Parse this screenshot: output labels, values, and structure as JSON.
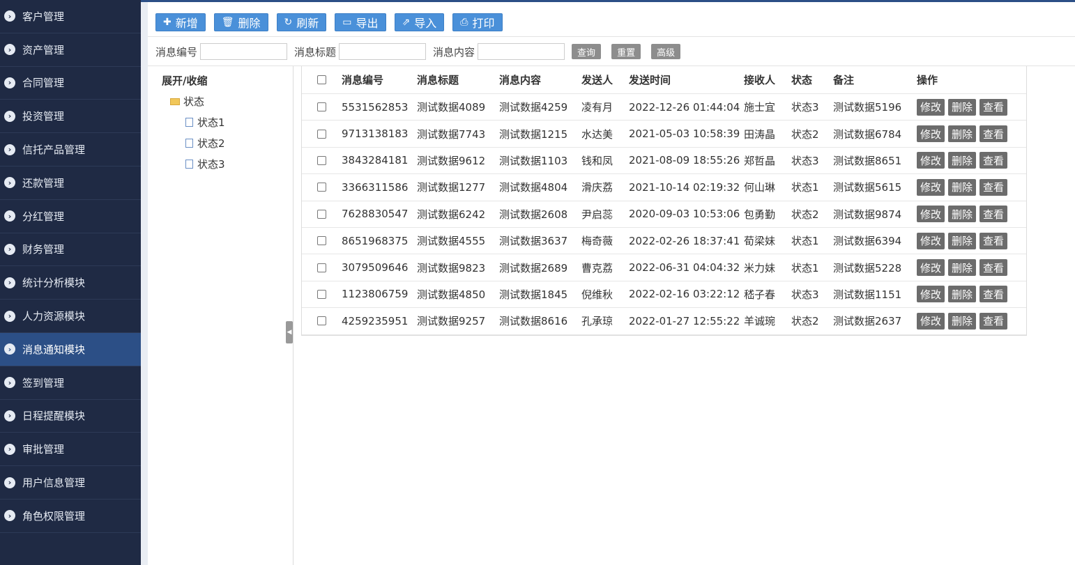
{
  "sidebar": {
    "items": [
      {
        "label": "客户管理",
        "icon": "chevron-right-circle-icon",
        "active": false
      },
      {
        "label": "资产管理",
        "icon": "chevron-right-circle-icon",
        "active": false
      },
      {
        "label": "合同管理",
        "icon": "chevron-right-circle-icon",
        "active": false
      },
      {
        "label": "投资管理",
        "icon": "chevron-right-circle-icon",
        "active": false
      },
      {
        "label": "信托产品管理",
        "icon": "chevron-right-circle-icon",
        "active": false
      },
      {
        "label": "还款管理",
        "icon": "chevron-right-circle-icon",
        "active": false
      },
      {
        "label": "分红管理",
        "icon": "chevron-right-circle-icon",
        "active": false
      },
      {
        "label": "财务管理",
        "icon": "chevron-right-circle-icon",
        "active": false
      },
      {
        "label": "统计分析模块",
        "icon": "chevron-right-circle-icon",
        "active": false
      },
      {
        "label": "人力资源模块",
        "icon": "chevron-right-circle-icon",
        "active": false
      },
      {
        "label": "消息通知模块",
        "icon": "chevron-right-circle-icon",
        "active": true
      },
      {
        "label": "签到管理",
        "icon": "chevron-right-circle-icon",
        "active": false
      },
      {
        "label": "日程提醒模块",
        "icon": "chevron-right-circle-icon",
        "active": false
      },
      {
        "label": "审批管理",
        "icon": "chevron-right-circle-icon",
        "active": false
      },
      {
        "label": "用户信息管理",
        "icon": "chevron-right-circle-icon",
        "active": false
      },
      {
        "label": "角色权限管理",
        "icon": "chevron-right-circle-icon",
        "active": false
      }
    ]
  },
  "toolbar": {
    "add": {
      "label": "新增",
      "icon": "plus-icon"
    },
    "delete": {
      "label": "删除",
      "icon": "trash-icon"
    },
    "refresh": {
      "label": "刷新",
      "icon": "refresh-icon"
    },
    "export": {
      "label": "导出",
      "icon": "folder-open-icon"
    },
    "import": {
      "label": "导入",
      "icon": "external-link-icon"
    },
    "print": {
      "label": "打印",
      "icon": "print-icon"
    }
  },
  "search": {
    "id_label": "消息编号",
    "id_value": "",
    "title_label": "消息标题",
    "title_value": "",
    "content_label": "消息内容",
    "content_value": "",
    "query_label": "查询",
    "reset_label": "重置",
    "advanced_label": "高级"
  },
  "tree": {
    "root_label": "展开/收缩",
    "folder_label": "状态",
    "leaves": [
      "状态1",
      "状态2",
      "状态3"
    ]
  },
  "table": {
    "headers": [
      "消息编号",
      "消息标题",
      "消息内容",
      "发送人",
      "发送时间",
      "接收人",
      "状态",
      "备注",
      "操作"
    ],
    "actions": {
      "edit": "修改",
      "delete": "删除",
      "view": "查看"
    },
    "rows": [
      [
        "5531562853",
        "测试数据4089",
        "测试数据4259",
        "凌有月",
        "2022-12-26 01:44:04",
        "施士宜",
        "状态3",
        "测试数据5196"
      ],
      [
        "9713138183",
        "测试数据7743",
        "测试数据1215",
        "水达美",
        "2021-05-03 10:58:39",
        "田涛晶",
        "状态2",
        "测试数据6784"
      ],
      [
        "3843284181",
        "测试数据9612",
        "测试数据1103",
        "钱和凤",
        "2021-08-09 18:55:26",
        "郑哲晶",
        "状态3",
        "测试数据8651"
      ],
      [
        "3366311586",
        "测试数据1277",
        "测试数据4804",
        "滑庆荔",
        "2021-10-14 02:19:32",
        "何山琳",
        "状态1",
        "测试数据5615"
      ],
      [
        "7628830547",
        "测试数据6242",
        "测试数据2608",
        "尹启蕊",
        "2020-09-03 10:53:06",
        "包勇勤",
        "状态2",
        "测试数据9874"
      ],
      [
        "8651968375",
        "测试数据4555",
        "测试数据3637",
        "梅奇薇",
        "2022-02-26 18:37:41",
        "荀梁妹",
        "状态1",
        "测试数据6394"
      ],
      [
        "3079509646",
        "测试数据9823",
        "测试数据2689",
        "曹克荔",
        "2022-06-31 04:04:32",
        "米力妹",
        "状态1",
        "测试数据5228"
      ],
      [
        "1123806759",
        "测试数据4850",
        "测试数据1845",
        "倪维秋",
        "2022-02-16 03:22:12",
        "嵇子春",
        "状态3",
        "测试数据1151"
      ],
      [
        "4259235951",
        "测试数据9257",
        "测试数据8616",
        "孔承琼",
        "2022-01-27 12:55:22",
        "羊诚琬",
        "状态2",
        "测试数据2637"
      ]
    ]
  }
}
